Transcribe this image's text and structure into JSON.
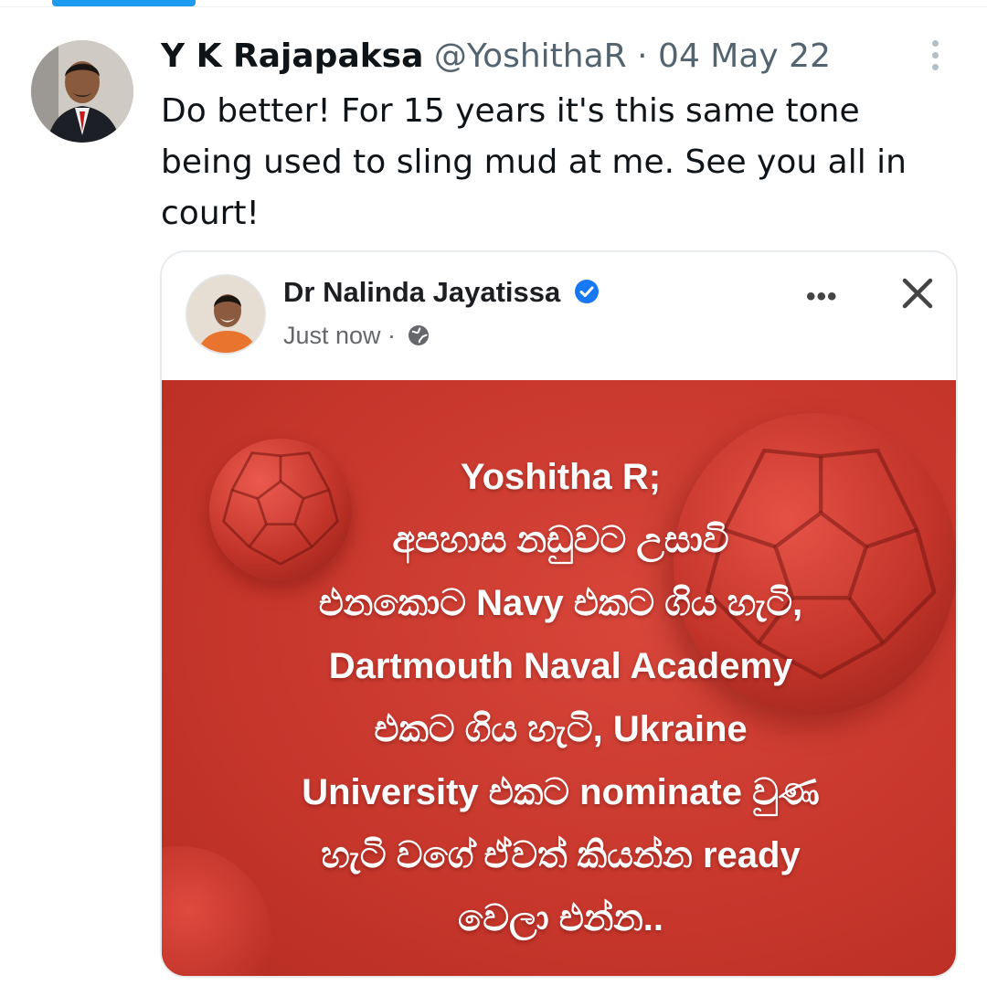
{
  "tweet": {
    "author_name": "Y K Rajapaksa",
    "author_handle": "@YoshithaR",
    "separator": "·",
    "date": "04 May 22",
    "text": "Do better! For 15 years it's this same tone being used to sling mud at me. See you all in court!",
    "avatar_icon": "profile-photo",
    "more_icon": "vertical-dots-icon"
  },
  "embedded_post": {
    "author_name": "Dr Nalinda Jayatissa",
    "verified_icon": "verified-badge-icon",
    "time": "Just now ·",
    "globe_icon": "globe-icon",
    "more_label": "•••",
    "close_icon": "close-icon",
    "image": {
      "background_color": "#c8372c",
      "lines": [
        "Yoshitha R;",
        "අපහාස නඩුවට උසාවි",
        "එනකොට Navy එකට ගිය හැටි,",
        "Dartmouth Naval Academy",
        "එකට  ගිය හැටි, Ukraine",
        "University එකට nominate වුණ",
        "හැටි වගේ ඒවත් කියන්න ready",
        "වෙලා එන්න.."
      ]
    }
  },
  "colors": {
    "accent": "#1d9bf0",
    "secondary_text": "#536471",
    "verified": "#1877f2"
  }
}
